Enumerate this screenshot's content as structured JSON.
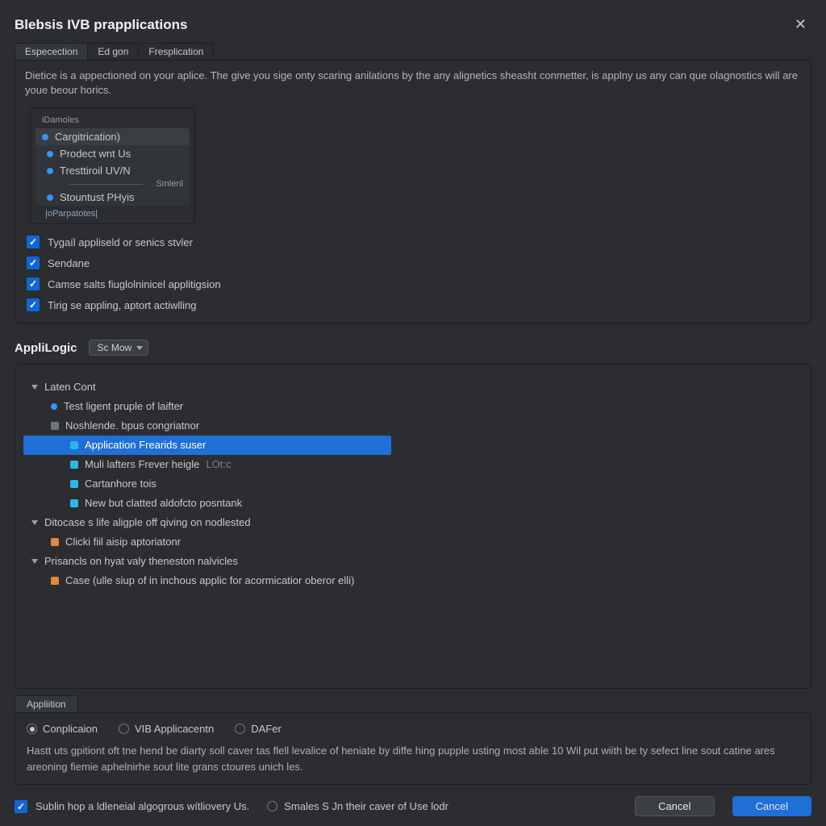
{
  "window": {
    "title": "Blebsis IVB prapplications",
    "close_tooltip": "Close"
  },
  "top_tabs": [
    "Especection",
    "Ed gon",
    "Fresplication"
  ],
  "top_tabs_active": 0,
  "intro": "Dietice is a appectioned on your aplice. The give you sige onty scaring anilations by the any alignetics sheasht conmetter, is applny us any can que olagnostics will are youe beour horics.",
  "group": {
    "label": "iDamoles",
    "header": "Cargitrication)",
    "items": [
      "Prodect wnt Us",
      "Tresttiroil UV/N",
      "Stountust PHyis"
    ],
    "sep_after": 1,
    "sep_label": "Smlenl",
    "move_select": "|oParpatotes|"
  },
  "checks": [
    "Tygaíl appliseld or senics stvler",
    "Sendane",
    "Camse salts fiuglolninicel applitigsion",
    "Tirig se appling, aptort actiwlling"
  ],
  "section2": {
    "title": "AppliLogic",
    "dropdown": "Sc Mow"
  },
  "tree": [
    {
      "lvl": 1,
      "type": "group",
      "label": "Laten Cont"
    },
    {
      "lvl": 2,
      "type": "blue-dot",
      "label": "Test ligent pruple of laifter"
    },
    {
      "lvl": 2,
      "type": "gray",
      "label": "Noshlende. bpus congriatnor"
    },
    {
      "lvl": 3,
      "type": "cyan",
      "label": "Application Frearids suser",
      "selected": true
    },
    {
      "lvl": 3,
      "type": "cyan",
      "label": "Muli lafters Frever heigle",
      "trail": "LOt:c"
    },
    {
      "lvl": 3,
      "type": "cyan",
      "label": "Cartanhore tois"
    },
    {
      "lvl": 3,
      "type": "cyan",
      "label": "New but clatted aldofcto posntank"
    },
    {
      "lvl": 1,
      "type": "group",
      "label": "Ditocase s life aligple off qiving on nodlested"
    },
    {
      "lvl": 2,
      "type": "orange",
      "label": "Clicki fiil aisip aptoriatonr"
    },
    {
      "lvl": 1,
      "type": "group",
      "label": "Prisancls on hyat valy theneston nalvicles"
    },
    {
      "lvl": 2,
      "type": "orange",
      "label": "Case (ulle siup of in inchous applic for acormicatior oberor elli)"
    }
  ],
  "bottom_tab": "Appliition",
  "radios": {
    "options": [
      "Conplicaion",
      "VIB Applicacentn",
      "DAFer"
    ],
    "selected": 0
  },
  "help_text": "Hastt uts gpitiont oft tne hend be diarty soll caver tas flell levalice of heniate by diffe hing pupple usting most able 10 Wil put wiith be ty sefect line sout catine ares areoning fiemie aphelnirhe sout lite grans ctoures unich les.",
  "footer": {
    "check_label": "Sublin hop a ldleneial algogrous wítliovery Us.",
    "radio_label": "Smales S Jn their caver of Use lodr",
    "btn_cancel": "Cancel",
    "btn_ok": "Cancel"
  }
}
